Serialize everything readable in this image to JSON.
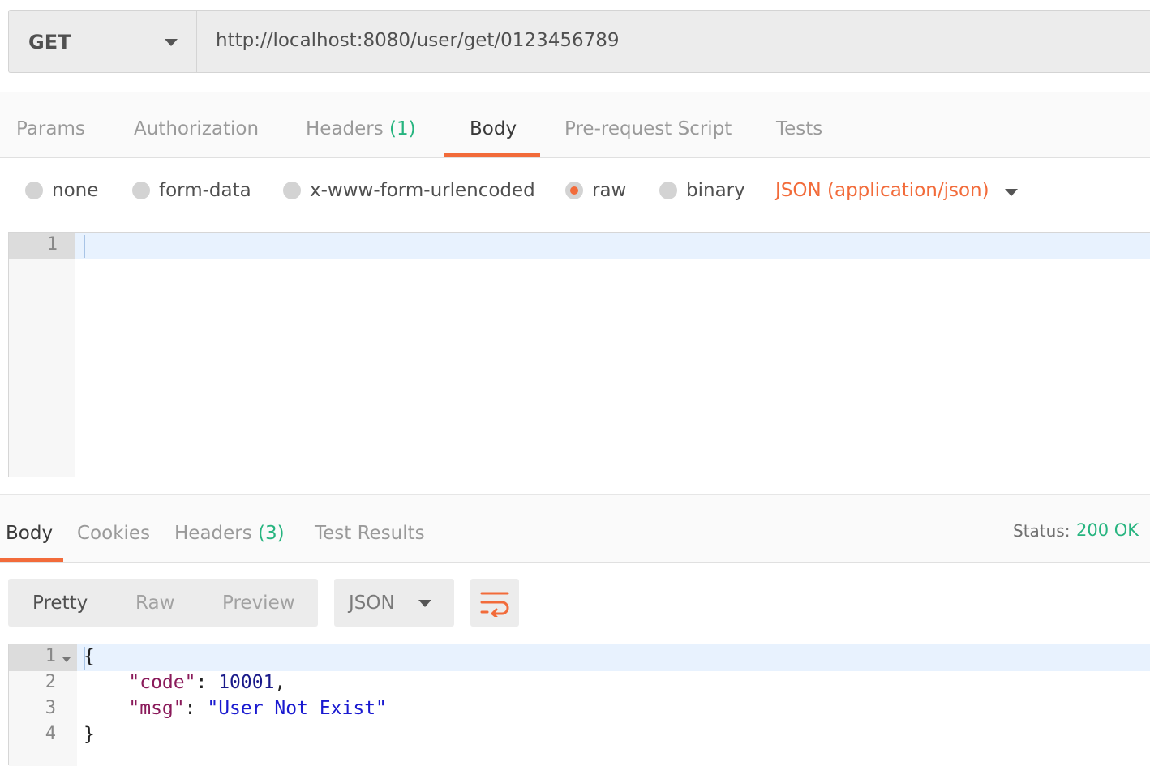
{
  "request": {
    "method": "GET",
    "url": "http://localhost:8080/user/get/0123456789"
  },
  "request_tabs": {
    "params": "Params",
    "authorization": "Authorization",
    "headers": "Headers",
    "headers_count": "(1)",
    "body": "Body",
    "prerequest": "Pre-request Script",
    "tests": "Tests",
    "active": "Body"
  },
  "body_types": {
    "none": "none",
    "form_data": "form-data",
    "urlencoded": "x-www-form-urlencoded",
    "raw": "raw",
    "binary": "binary",
    "selected": "raw",
    "content_type": "JSON (application/json)"
  },
  "request_editor": {
    "line_numbers": [
      "1"
    ]
  },
  "response_tabs": {
    "body": "Body",
    "cookies": "Cookies",
    "headers": "Headers",
    "headers_count": "(3)",
    "test_results": "Test Results",
    "active": "Body"
  },
  "status": {
    "label": "Status:",
    "value": "200 OK"
  },
  "response_toolbar": {
    "pretty": "Pretty",
    "raw": "Raw",
    "preview": "Preview",
    "format": "JSON",
    "active_view": "Pretty"
  },
  "response_editor": {
    "line_numbers": [
      "1",
      "2",
      "3",
      "4"
    ],
    "open_brace": "{",
    "close_brace": "}",
    "code_key": "\"code\"",
    "code_value": "10001",
    "msg_key": "\"msg\"",
    "msg_value": "\"User Not Exist\""
  },
  "colors": {
    "accent": "#f26b3a",
    "count": "#26b47f",
    "status_ok": "#26b47f"
  }
}
